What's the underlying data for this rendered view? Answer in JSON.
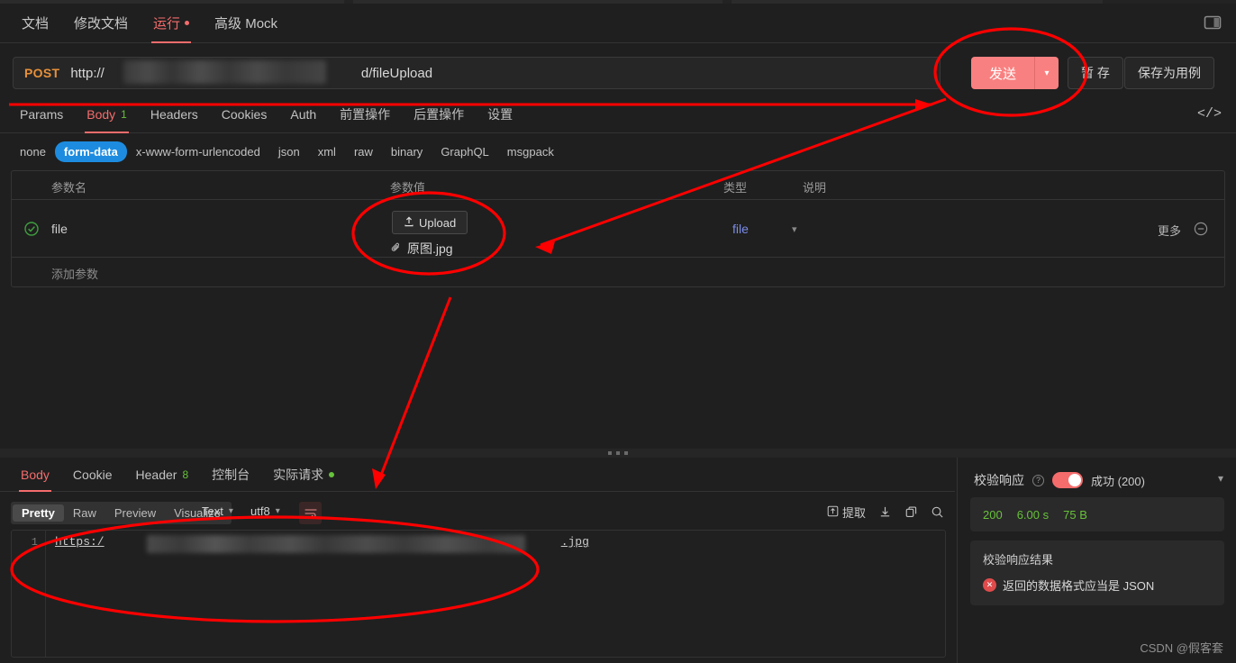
{
  "window": {
    "panel_toggle_icon": "panel-layout-icon"
  },
  "main_tabs": [
    {
      "label": "文档",
      "active": false,
      "dot": false
    },
    {
      "label": "修改文档",
      "active": false,
      "dot": false
    },
    {
      "label": "运行",
      "active": true,
      "dot": true
    },
    {
      "label": "高级 Mock",
      "active": false,
      "dot": false
    }
  ],
  "request": {
    "method": "POST",
    "url_prefix": "http://",
    "url_suffix": "d/fileUpload",
    "send_label": "发送",
    "send_caret_icon": "chevron-down-icon",
    "save_label": "暂 存",
    "save_case_label": "保存为用例",
    "code_icon": "code-brackets-icon"
  },
  "request_tabs": [
    {
      "label": "Params",
      "badge": "",
      "active": false
    },
    {
      "label": "Body",
      "badge": "1",
      "active": true
    },
    {
      "label": "Headers",
      "badge": "",
      "active": false
    },
    {
      "label": "Cookies",
      "badge": "",
      "active": false
    },
    {
      "label": "Auth",
      "badge": "",
      "active": false
    },
    {
      "label": "前置操作",
      "badge": "",
      "active": false
    },
    {
      "label": "后置操作",
      "badge": "",
      "active": false
    },
    {
      "label": "设置",
      "badge": "",
      "active": false
    }
  ],
  "body_types": [
    {
      "label": "none",
      "active": false
    },
    {
      "label": "form-data",
      "active": true
    },
    {
      "label": "x-www-form-urlencoded",
      "active": false
    },
    {
      "label": "json",
      "active": false
    },
    {
      "label": "xml",
      "active": false
    },
    {
      "label": "raw",
      "active": false
    },
    {
      "label": "binary",
      "active": false
    },
    {
      "label": "GraphQL",
      "active": false
    },
    {
      "label": "msgpack",
      "active": false
    }
  ],
  "params_table": {
    "columns": {
      "name": "参数名",
      "value": "参数值",
      "type": "类型",
      "desc": "说明"
    },
    "row": {
      "checked_icon": "check-circle-icon",
      "name": "file",
      "upload_label": "Upload",
      "upload_icon": "upload-icon",
      "file_name": "原图.jpg",
      "file_icon": "paperclip-icon",
      "type_value": "file",
      "type_caret_icon": "chevron-down-icon",
      "more_label": "更多",
      "remove_icon": "minus-circle-icon"
    },
    "add_row_label": "添加参数"
  },
  "response_tabs": [
    {
      "label": "Body",
      "badge": "",
      "dot": false,
      "active": true
    },
    {
      "label": "Cookie",
      "badge": "",
      "dot": false,
      "active": false
    },
    {
      "label": "Header",
      "badge": "8",
      "dot": false,
      "active": false
    },
    {
      "label": "控制台",
      "badge": "",
      "dot": false,
      "active": false
    },
    {
      "label": "实际请求",
      "badge": "",
      "dot": true,
      "active": false
    }
  ],
  "response_view": {
    "modes": [
      {
        "label": "Pretty",
        "active": true
      },
      {
        "label": "Raw",
        "active": false
      },
      {
        "label": "Preview",
        "active": false
      },
      {
        "label": "Visualize",
        "active": false
      }
    ],
    "format": "Text",
    "encoding": "utf8",
    "wrap_icon": "word-wrap-icon",
    "extract_label": "提取",
    "extract_icon": "extract-icon",
    "download_icon": "download-icon",
    "copy_icon": "copy-icon",
    "search_icon": "search-icon"
  },
  "response_body": {
    "line_number": "1",
    "text_prefix": "https:/",
    "text_suffix": ".jpg"
  },
  "validation": {
    "title": "校验响应",
    "help_icon": "question-circle-icon",
    "toggle_on": true,
    "status": "成功 (200)",
    "collapse_icon": "chevron-down-icon",
    "stats": {
      "code": "200",
      "time": "6.00 s",
      "size": "75 B"
    },
    "result_title": "校验响应结果",
    "errors": [
      {
        "icon": "error-icon",
        "message": "返回的数据格式应当是 JSON"
      }
    ]
  },
  "watermark": "CSDN @假客套",
  "colors": {
    "accent_red": "#f56c6c",
    "send_button": "#f98080",
    "method_orange": "#e8913a",
    "success_green": "#67c23a",
    "chip_blue": "#1d8ce0",
    "type_link": "#7b8ce8",
    "annotation_red": "#ff0000"
  }
}
